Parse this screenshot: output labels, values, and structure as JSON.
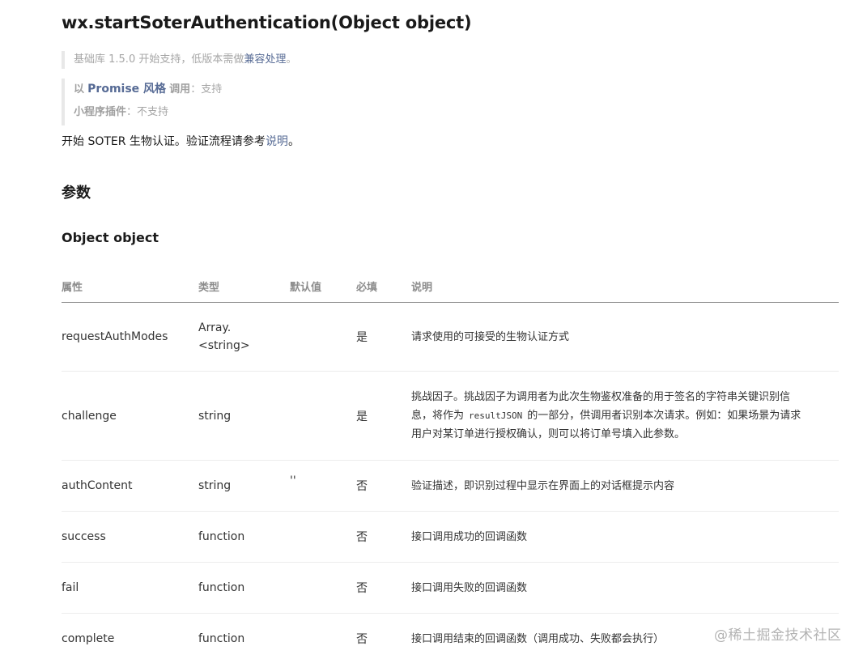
{
  "title": "wx.startSoterAuthentication(Object object)",
  "since_note": {
    "prefix": "基础库 1.5.0 开始支持，低版本需做",
    "link": "兼容处理",
    "suffix": "。"
  },
  "support_note": {
    "promise_prefix": "以",
    "promise_link": "Promise 风格",
    "promise_label": "调用",
    "promise_sep": "：",
    "promise_value": "支持",
    "plugin_label": "小程序插件",
    "plugin_sep": "：",
    "plugin_value": "不支持"
  },
  "description": {
    "text": "开始 SOTER 生物认证。验证流程请参考",
    "link": "说明",
    "suffix": "。"
  },
  "params_heading": "参数",
  "object_heading": "Object object",
  "table": {
    "headers": [
      "属性",
      "类型",
      "默认值",
      "必填",
      "说明"
    ],
    "rows": [
      {
        "name": "requestAuthModes",
        "type_line1": "Array.",
        "type_line2": "<string>",
        "default": "",
        "required": "是",
        "desc": "请求使用的可接受的生物认证方式"
      },
      {
        "name": "challenge",
        "type": "string",
        "default": "",
        "required": "是",
        "desc_line1": "挑战因子。挑战因子为调用者为此次生物鉴权准备的用于签名的字符串关键识别信",
        "desc_line2_pre": "息，将作为",
        "desc_line2_code": "resultJSON",
        "desc_line2_post": "的一部分，供调用者识别本次请求。例如：如果场景为请求",
        "desc_line3": "用户对某订单进行授权确认，则可以将订单号填入此参数。"
      },
      {
        "name": "authContent",
        "type": "string",
        "default": "''",
        "required": "否",
        "desc": "验证描述，即识别过程中显示在界面上的对话框提示内容"
      },
      {
        "name": "success",
        "type": "function",
        "default": "",
        "required": "否",
        "desc": "接口调用成功的回调函数"
      },
      {
        "name": "fail",
        "type": "function",
        "default": "",
        "required": "否",
        "desc": "接口调用失败的回调函数"
      },
      {
        "name": "complete",
        "type": "function",
        "default": "",
        "required": "否",
        "desc": "接口调用结束的回调函数（调用成功、失败都会执行）"
      }
    ]
  },
  "watermark": "@稀土掘金技术社区"
}
